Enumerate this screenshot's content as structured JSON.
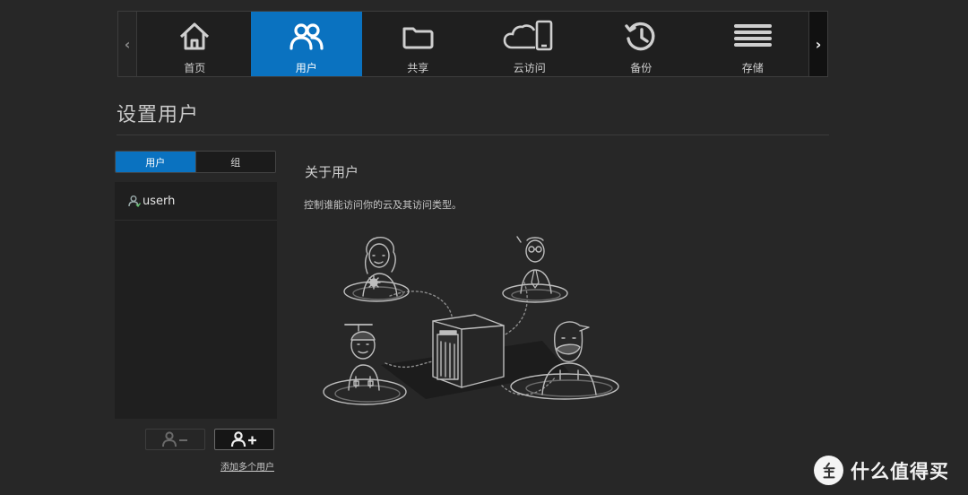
{
  "nav": {
    "items": [
      {
        "label": "首页",
        "icon": "home-icon",
        "active": false
      },
      {
        "label": "用户",
        "icon": "users-icon",
        "active": true
      },
      {
        "label": "共享",
        "icon": "folder-icon",
        "active": false
      },
      {
        "label": "云访问",
        "icon": "cloud-phone-icon",
        "active": false
      },
      {
        "label": "备份",
        "icon": "history-icon",
        "active": false
      },
      {
        "label": "存储",
        "icon": "storage-icon",
        "active": false
      }
    ],
    "prev_icon": "chevron-left-icon",
    "next_icon": "chevron-right-icon"
  },
  "page": {
    "title": "设置用户"
  },
  "segment": {
    "users_label": "用户",
    "groups_label": "组",
    "selected": "用户"
  },
  "user_list": [
    {
      "name": "userh",
      "icon": "user-icon"
    }
  ],
  "actions": {
    "remove_icon": "remove-user-icon",
    "add_icon": "add-user-icon",
    "add_multiple_label": "添加多个用户"
  },
  "about": {
    "title": "关于用户",
    "description": "控制谁能访问你的云及其访问类型。"
  },
  "watermark": {
    "text": "什么值得买",
    "icon": "zhi-logo-icon"
  },
  "colors": {
    "accent": "#0a72c0",
    "background": "#272727",
    "panel": "#1f1f1f"
  }
}
